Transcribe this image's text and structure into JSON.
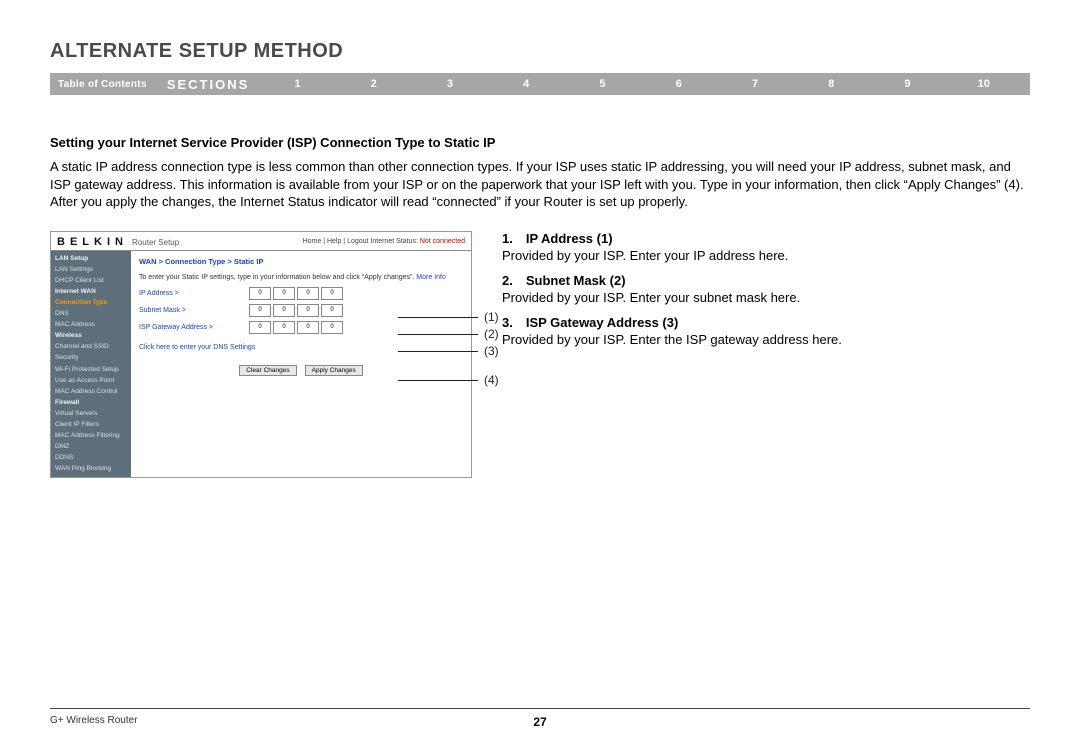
{
  "title": "ALTERNATE SETUP METHOD",
  "nav": {
    "toc": "Table of Contents",
    "sections": "SECTIONS",
    "numbers": [
      "1",
      "2",
      "3",
      "4",
      "5",
      "6",
      "7",
      "8",
      "9",
      "10"
    ],
    "active": "5"
  },
  "subheading": "Setting your Internet Service Provider (ISP) Connection Type to Static IP",
  "paragraph": "A static IP address connection type is less common than other connection types. If your ISP uses static IP addressing, you will need your IP address, subnet mask, and ISP gateway address. This information is available from your ISP or on the paperwork that your ISP left with you. Type in your information, then click “Apply Changes” (4). After you apply the changes, the Internet Status indicator will read “connected” if your Router is set up properly.",
  "router": {
    "logo": "BELKIN",
    "setup": "Router Setup",
    "header_links": "Home | Help | Logout  Internet Status:",
    "status": "Not connected",
    "breadcrumb": "WAN > Connection Type > Static IP",
    "instruction": "To enter your Static IP settings, type in your information below and click “Apply changes”.",
    "more": "More Info",
    "labels": {
      "ip": "IP Address >",
      "subnet": "Subnet Mask >",
      "gateway": "ISP Gateway Address >"
    },
    "octet": "0",
    "dns_link": "Click here to enter your DNS Settings",
    "clear_btn": "Clear Changes",
    "apply_btn": "Apply Changes",
    "sidebar": {
      "items": [
        {
          "t": "LAN Setup",
          "c": "cat"
        },
        {
          "t": "LAN Settings"
        },
        {
          "t": "DHCP Client List"
        },
        {
          "t": "Internet WAN",
          "c": "cat"
        },
        {
          "t": "Connection Type",
          "c": "hl"
        },
        {
          "t": "DNS"
        },
        {
          "t": "MAC Address"
        },
        {
          "t": "Wireless",
          "c": "cat"
        },
        {
          "t": "Channel and SSID"
        },
        {
          "t": "Security"
        },
        {
          "t": "Wi-Fi Protected Setup"
        },
        {
          "t": "Use as Access Point"
        },
        {
          "t": "MAC Address Control"
        },
        {
          "t": "Firewall",
          "c": "cat"
        },
        {
          "t": "Virtual Servers"
        },
        {
          "t": "Client IP Filters"
        },
        {
          "t": "MAC Address Filtering"
        },
        {
          "t": "DMZ"
        },
        {
          "t": "DDNS"
        },
        {
          "t": "WAN Ping Blocking"
        }
      ]
    }
  },
  "callouts": [
    "(1)",
    "(2)",
    "(3)",
    "(4)"
  ],
  "defs": [
    {
      "title": "1. IP Address (1)",
      "text": "Provided by your ISP. Enter your IP address here."
    },
    {
      "title": "2. Subnet Mask (2)",
      "text": "Provided by your ISP. Enter your subnet mask here."
    },
    {
      "title": "3. ISP Gateway Address (3)",
      "text": "Provided by your ISP. Enter the ISP gateway address here."
    }
  ],
  "footer": {
    "left": "G+ Wireless Router",
    "page": "27"
  }
}
